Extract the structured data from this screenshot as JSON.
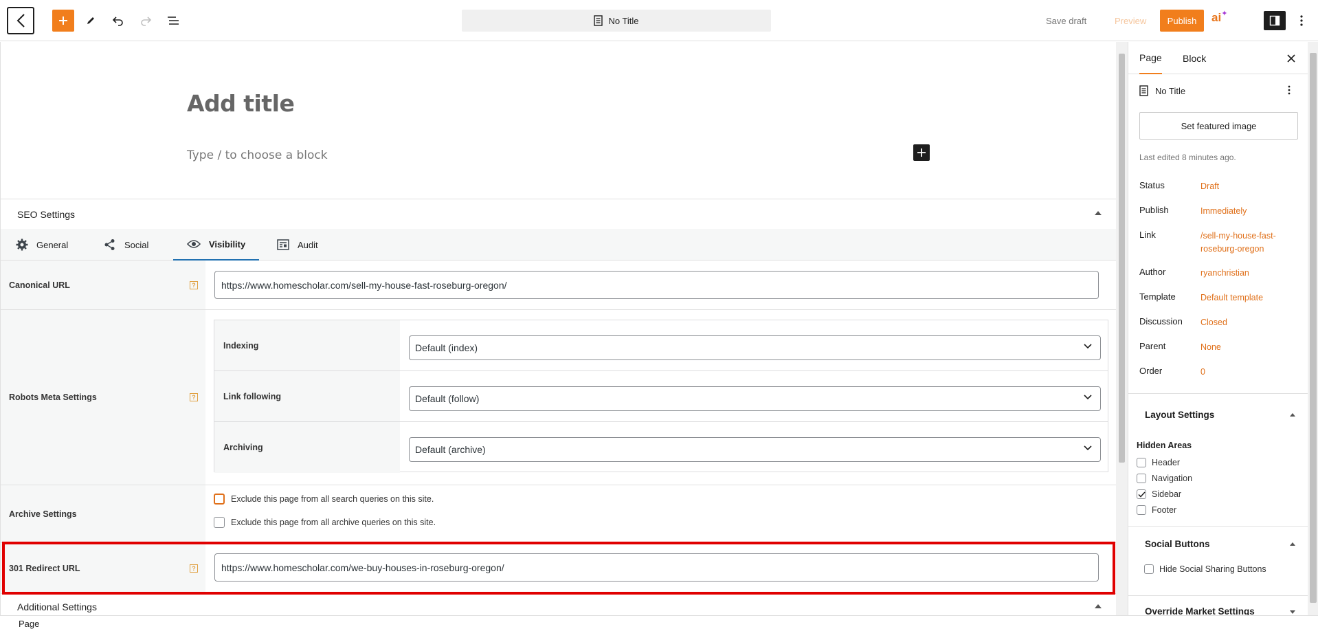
{
  "topbar": {
    "doc_title": "No Title",
    "save_draft": "Save draft",
    "preview": "Preview",
    "publish": "Publish",
    "ai_logo": "ai"
  },
  "editor": {
    "title_placeholder": "Add title",
    "block_placeholder": "Type / to choose a block"
  },
  "seo": {
    "header": "SEO Settings",
    "tabs": [
      {
        "label": "General",
        "icon": "gear-icon"
      },
      {
        "label": "Social",
        "icon": "share-icon"
      },
      {
        "label": "Visibility",
        "icon": "eye-icon"
      },
      {
        "label": "Audit",
        "icon": "audit-icon"
      }
    ],
    "canonical": {
      "label": "Canonical URL",
      "value": "https://www.homescholar.com/sell-my-house-fast-roseburg-oregon/"
    },
    "robots": {
      "label": "Robots Meta Settings",
      "rows": [
        {
          "label": "Indexing",
          "value": "Default (index)"
        },
        {
          "label": "Link following",
          "value": "Default (follow)"
        },
        {
          "label": "Archiving",
          "value": "Default (archive)"
        }
      ]
    },
    "archive": {
      "label": "Archive Settings",
      "options": [
        "Exclude this page from all search queries on this site.",
        "Exclude this page from all archive queries on this site."
      ]
    },
    "redirect": {
      "label": "301 Redirect URL",
      "value": "https://www.homescholar.com/we-buy-houses-in-roseburg-oregon/"
    },
    "help_glyph": "?"
  },
  "additional_settings": "Additional Settings",
  "statusbar": "Page",
  "sidebar": {
    "tabs": [
      "Page",
      "Block"
    ],
    "doc_title": "No Title",
    "featured_image": "Set featured image",
    "last_edited": "Last edited 8 minutes ago.",
    "meta": [
      {
        "key": "Status",
        "value": "Draft"
      },
      {
        "key": "Publish",
        "value": "Immediately"
      },
      {
        "key": "Link",
        "value": "/sell-my-house-fast-roseburg-oregon"
      },
      {
        "key": "Author",
        "value": "ryanchristian"
      },
      {
        "key": "Template",
        "value": "Default template"
      },
      {
        "key": "Discussion",
        "value": "Closed"
      },
      {
        "key": "Parent",
        "value": "None"
      },
      {
        "key": "Order",
        "value": "0"
      }
    ],
    "layout_settings": {
      "title": "Layout Settings",
      "subtitle": "Hidden Areas",
      "areas": [
        {
          "label": "Header",
          "checked": false
        },
        {
          "label": "Navigation",
          "checked": false
        },
        {
          "label": "Sidebar",
          "checked": true
        },
        {
          "label": "Footer",
          "checked": false
        }
      ]
    },
    "social_buttons": {
      "title": "Social Buttons",
      "option": "Hide Social Sharing Buttons"
    },
    "override_market": "Override Market Settings"
  },
  "colors": {
    "accent": "#f17e1c",
    "link": "#e0701a",
    "highlight": "#e00000",
    "active_tab": "#2271b1"
  }
}
